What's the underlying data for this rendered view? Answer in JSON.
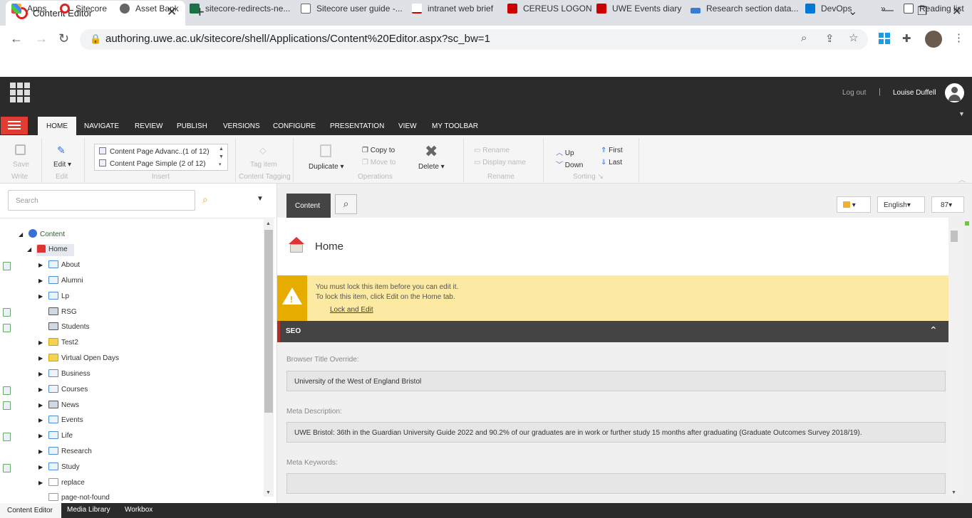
{
  "browser": {
    "tab_title": "Content Editor",
    "url": "authoring.uwe.ac.uk/sitecore/shell/Applications/Content%20Editor.aspx?sc_bw=1",
    "bookmarks": [
      "Apps",
      "Sitecore",
      "Asset Bank",
      "sitecore-redirects-ne...",
      "Sitecore user guide -...",
      "intranet web brief",
      "CEREUS LOGON",
      "UWE Events diary",
      "Research section data...",
      "DevOps"
    ],
    "more_bookmarks": "»",
    "reading_list": "Reading list"
  },
  "header": {
    "logout": "Log out",
    "separator": "|",
    "user_name": "Louise Duffell"
  },
  "ribbon_tabs": [
    "HOME",
    "NAVIGATE",
    "REVIEW",
    "PUBLISH",
    "VERSIONS",
    "CONFIGURE",
    "PRESENTATION",
    "VIEW",
    "MY TOOLBAR"
  ],
  "ribbon": {
    "save": "Save",
    "write": "Write",
    "edit": "Edit",
    "edit_group": "Edit",
    "insert_items": [
      "Content Page Advanc..(1 of 12)",
      "Content Page Simple   (2 of 12)"
    ],
    "insert_group": "Insert",
    "tag_item": "Tag item",
    "content_tagging": "Content Tagging",
    "duplicate": "Duplicate",
    "copy_to": "Copy to",
    "move_to": "Move to",
    "delete": "Delete",
    "operations": "Operations",
    "rename": "Rename",
    "display_name": "Display name",
    "rename_group": "Rename",
    "up": "Up",
    "down": "Down",
    "first": "First",
    "last": "Last",
    "sorting": "Sorting"
  },
  "tree": {
    "search_placeholder": "Search",
    "root": "Content",
    "home": "Home",
    "items": [
      {
        "label": "About",
        "icon": "page"
      },
      {
        "label": "Alumni",
        "icon": "page"
      },
      {
        "label": "Lp",
        "icon": "page"
      },
      {
        "label": "RSG",
        "icon": "image"
      },
      {
        "label": "Students",
        "icon": "image"
      },
      {
        "label": "Test2",
        "icon": "folder"
      },
      {
        "label": "Virtual Open Days",
        "icon": "folder"
      },
      {
        "label": "Business",
        "icon": "page"
      },
      {
        "label": "Courses",
        "icon": "page"
      },
      {
        "label": "News",
        "icon": "news"
      },
      {
        "label": "Events",
        "icon": "page"
      },
      {
        "label": "Life",
        "icon": "page"
      },
      {
        "label": "Research",
        "icon": "page"
      },
      {
        "label": "Study",
        "icon": "page"
      },
      {
        "label": "replace",
        "icon": "doc"
      },
      {
        "label": "page-not-found",
        "icon": "doc"
      }
    ]
  },
  "editor": {
    "content_tab": "Content",
    "language": "English",
    "version": "87",
    "item_title": "Home",
    "warning_line1": "You must lock this item before you can edit it.",
    "warning_line2": "To lock this item, click Edit on the Home tab.",
    "lock_link": "Lock and Edit",
    "section": "SEO",
    "fields": [
      {
        "label": "Browser Title Override:",
        "value": "University of the West of England Bristol"
      },
      {
        "label": "Meta Description:",
        "value": "UWE Bristol: 36th in the Guardian University Guide 2022 and 90.2% of our graduates are in work or further study 15 months after graduating (Graduate Outcomes Survey 2018/19)."
      },
      {
        "label": "Meta Keywords:",
        "value": ""
      }
    ]
  },
  "bottom_tabs": [
    "Content Editor",
    "Media Library",
    "Workbox"
  ],
  "colors": {
    "accent": "#e03c31",
    "header": "#2b2b2b",
    "warning": "#fce9a2",
    "warning_icon": "#e6ac00"
  }
}
